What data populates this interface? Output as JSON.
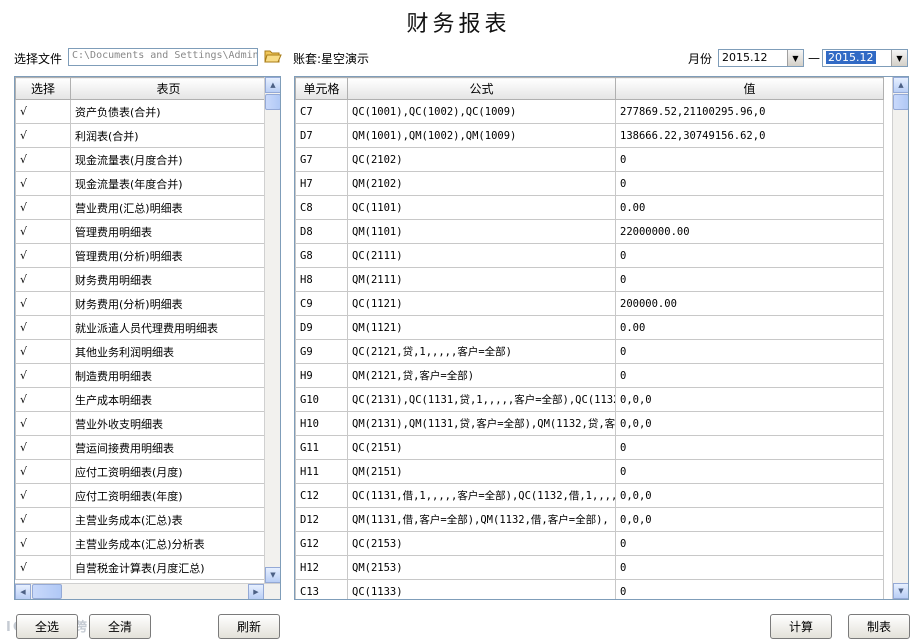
{
  "title": "财务报表",
  "toolbar": {
    "file_label": "选择文件",
    "file_value": "C:\\Documents and Settings\\Admin",
    "account_label": "账套:星空演示",
    "month_label": "月份",
    "month_from": "2015.12",
    "month_sep": "—",
    "month_to": "2015.12"
  },
  "left_table": {
    "headers": [
      "选择",
      "表页"
    ],
    "rows": [
      {
        "check": "√",
        "name": "资产负债表(合并)"
      },
      {
        "check": "√",
        "name": "利润表(合并)"
      },
      {
        "check": "√",
        "name": "现金流量表(月度合并)"
      },
      {
        "check": "√",
        "name": "现金流量表(年度合并)"
      },
      {
        "check": "√",
        "name": "营业费用(汇总)明细表"
      },
      {
        "check": "√",
        "name": "管理费用明细表"
      },
      {
        "check": "√",
        "name": "管理费用(分析)明细表"
      },
      {
        "check": "√",
        "name": "财务费用明细表"
      },
      {
        "check": "√",
        "name": "财务费用(分析)明细表"
      },
      {
        "check": "√",
        "name": "就业派遣人员代理费用明细表"
      },
      {
        "check": "√",
        "name": "其他业务利润明细表"
      },
      {
        "check": "√",
        "name": "制造费用明细表"
      },
      {
        "check": "√",
        "name": "生产成本明细表"
      },
      {
        "check": "√",
        "name": "营业外收支明细表"
      },
      {
        "check": "√",
        "name": "营运间接费用明细表"
      },
      {
        "check": "√",
        "name": "应付工资明细表(月度)"
      },
      {
        "check": "√",
        "name": "应付工资明细表(年度)"
      },
      {
        "check": "√",
        "name": "主营业务成本(汇总)表"
      },
      {
        "check": "√",
        "name": "主营业务成本(汇总)分析表"
      },
      {
        "check": "√",
        "name": "自营税金计算表(月度汇总)"
      }
    ]
  },
  "right_table": {
    "headers": [
      "单元格",
      "公式",
      "值"
    ],
    "rows": [
      {
        "cell": "C7",
        "formula": "QC(1001),QC(1002),QC(1009)",
        "value": "277869.52,21100295.96,0"
      },
      {
        "cell": "D7",
        "formula": "QM(1001),QM(1002),QM(1009)",
        "value": "138666.22,30749156.62,0"
      },
      {
        "cell": "G7",
        "formula": "QC(2102)",
        "value": "0"
      },
      {
        "cell": "H7",
        "formula": "QM(2102)",
        "value": "0"
      },
      {
        "cell": "C8",
        "formula": "QC(1101)",
        "value": "0.00"
      },
      {
        "cell": "D8",
        "formula": "QM(1101)",
        "value": "22000000.00"
      },
      {
        "cell": "G8",
        "formula": "QC(2111)",
        "value": "0"
      },
      {
        "cell": "H8",
        "formula": "QM(2111)",
        "value": "0"
      },
      {
        "cell": "C9",
        "formula": "QC(1121)",
        "value": "200000.00"
      },
      {
        "cell": "D9",
        "formula": "QM(1121)",
        "value": "0.00"
      },
      {
        "cell": "G9",
        "formula": "QC(2121,贷,1,,,,,客户=全部)",
        "value": "0"
      },
      {
        "cell": "H9",
        "formula": "QM(2121,贷,客户=全部)",
        "value": "0"
      },
      {
        "cell": "G10",
        "formula": "QC(2131),QC(1131,贷,1,,,,,客户=全部),QC(1132",
        "value": "0,0,0"
      },
      {
        "cell": "H10",
        "formula": "QM(2131),QM(1131,贷,客户=全部),QM(1132,贷,客",
        "value": "0,0,0"
      },
      {
        "cell": "G11",
        "formula": "QC(2151)",
        "value": "0"
      },
      {
        "cell": "H11",
        "formula": "QM(2151)",
        "value": "0"
      },
      {
        "cell": "C12",
        "formula": "QC(1131,借,1,,,,,客户=全部),QC(1132,借,1,,,,",
        "value": "0,0,0"
      },
      {
        "cell": "D12",
        "formula": "QM(1131,借,客户=全部),QM(1132,借,客户=全部),",
        "value": "0,0,0"
      },
      {
        "cell": "G12",
        "formula": "QC(2153)",
        "value": "0"
      },
      {
        "cell": "H12",
        "formula": "QM(2153)",
        "value": "0"
      },
      {
        "cell": "C13",
        "formula": "QC(1133)",
        "value": "0"
      }
    ]
  },
  "buttons": {
    "select_all": "全选",
    "clear_all": "全清",
    "refresh": "刷新",
    "calculate": "计算",
    "make_report": "制表"
  },
  "icons": {
    "folder": "folder-open-icon",
    "scroll_up": "scroll-up-icon",
    "scroll_down": "scroll-down-icon",
    "scroll_left": "scroll-left-icon",
    "scroll_right": "scroll-right-icon",
    "dropdown": "chevron-down-icon"
  },
  "colors": {
    "selection": "#316ac5",
    "grid_border": "#7f9db9"
  }
}
